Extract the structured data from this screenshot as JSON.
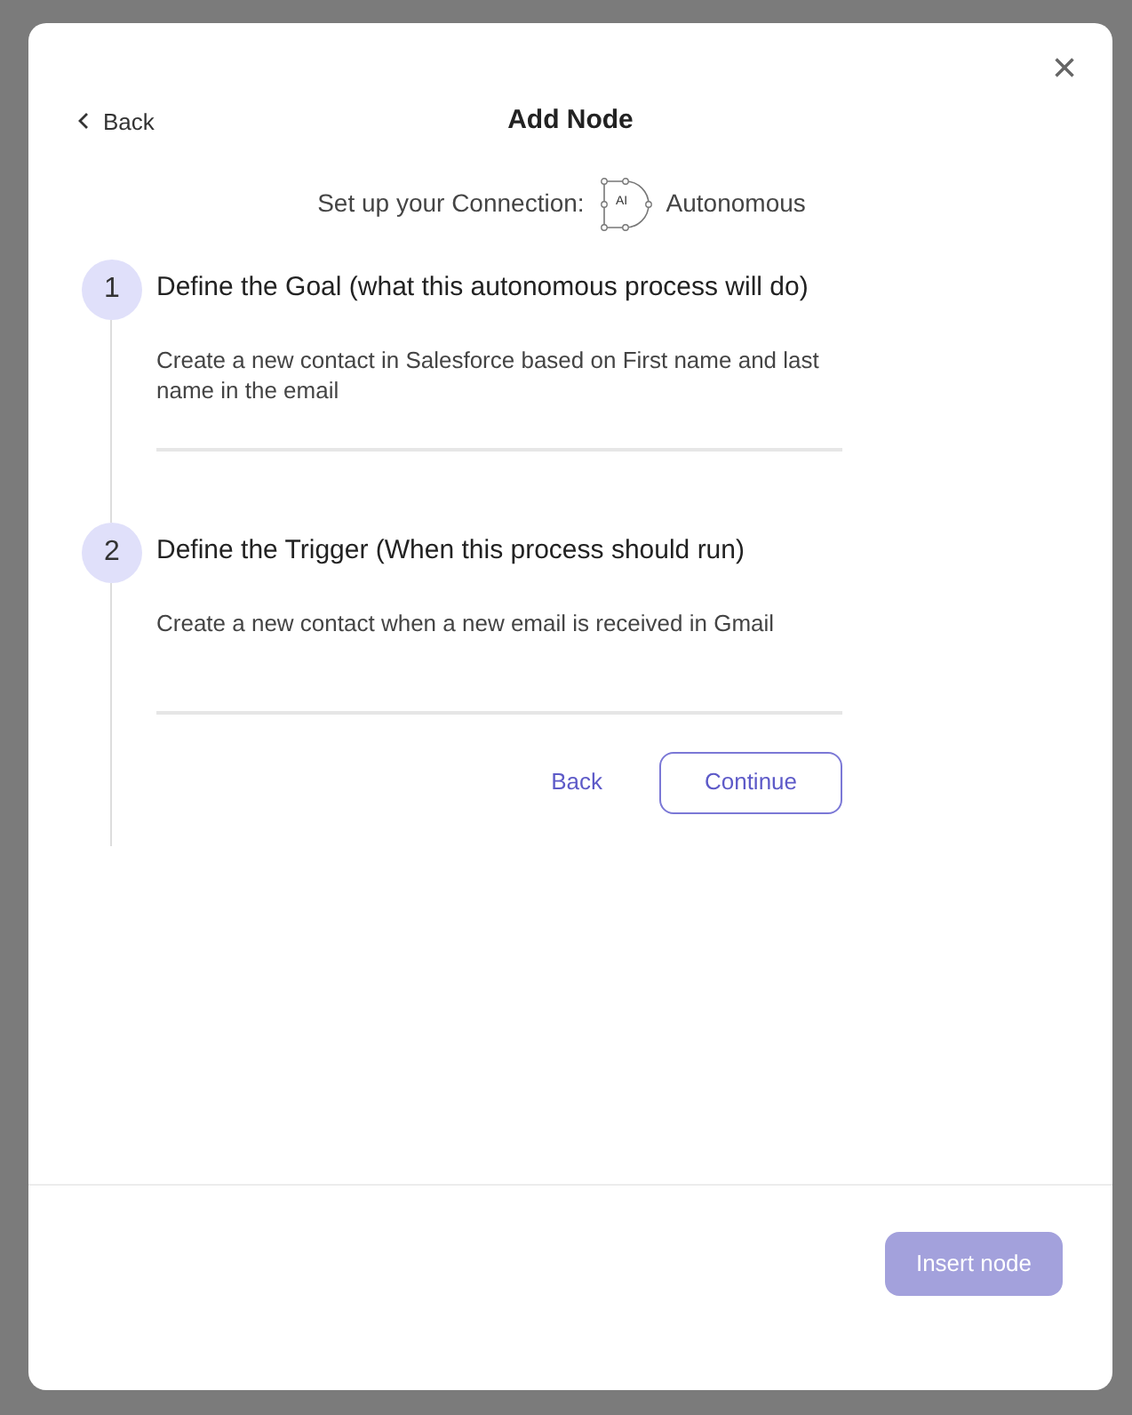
{
  "dialog": {
    "back_link": "Back",
    "title": "Add Node",
    "close_label": "×",
    "subtitle": "Set up your Connection:",
    "connection_icon_text": "AI",
    "connection_type": "Autonomous"
  },
  "steps": [
    {
      "number": "1",
      "title": "Define the Goal (what this autonomous process will do)",
      "value": "Create a new contact in Salesforce based on First name and last name in the email"
    },
    {
      "number": "2",
      "title": "Define the Trigger (When this process should run)",
      "value": "Create a new contact when a new email is received in Gmail",
      "actions": [
        {
          "label": "Back",
          "kind": "link"
        },
        {
          "label": "Continue",
          "kind": "outline"
        }
      ]
    }
  ],
  "footer": {
    "insert_button": {
      "label": "Insert node",
      "disabled": true
    }
  }
}
